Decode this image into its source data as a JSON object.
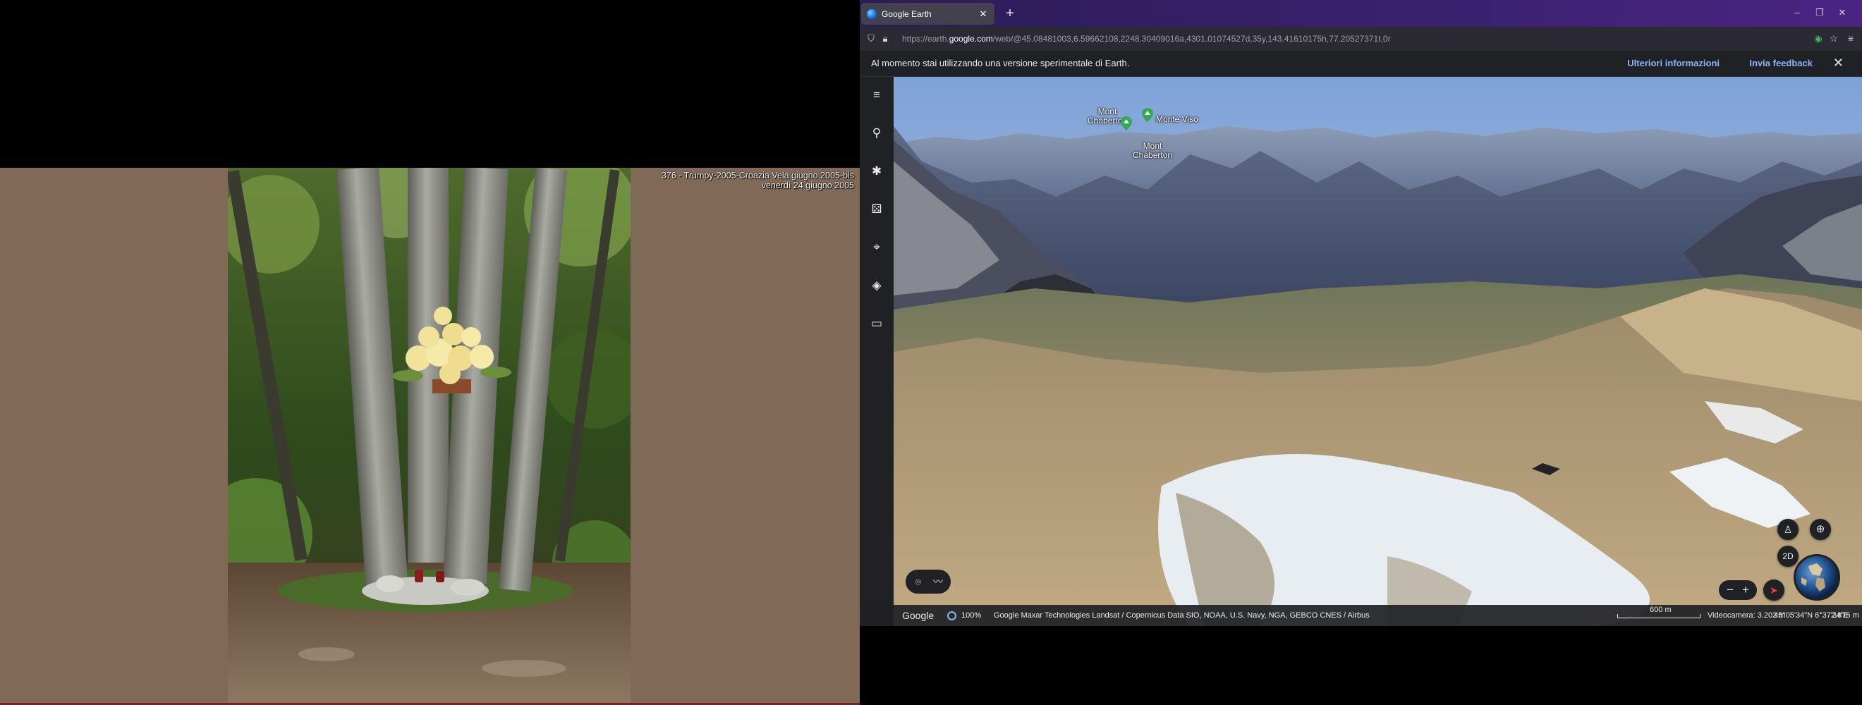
{
  "photo_viewer": {
    "caption_line1": "376 - Trumpy-2005-Croazia Vela giugno 2005-bis",
    "caption_line2": "venerdì 24 giugno 2005"
  },
  "browser": {
    "tab_title": "Google Earth",
    "tab_close_icon": "close-icon",
    "new_tab_glyph": "+",
    "window_controls": [
      "–",
      "❐",
      "✕"
    ],
    "url_prefix": "https://earth.",
    "url_host": "google.com",
    "url_path": "/web/@45.08481003,6.59662108,2248.30409016a,4301.01074527d,35y,143.41610175h,77.20527371t,0r"
  },
  "infobar": {
    "message": "Al momento stai utilizzando una versione sperimentale di Earth.",
    "more_info": "Ulteriori informazioni",
    "feedback": "Invia feedback",
    "close": "✕"
  },
  "earth": {
    "rail_icons": [
      "menu-icon",
      "search-icon",
      "voyager-icon",
      "dice-icon",
      "projects-icon",
      "layers-icon",
      "ruler-icon"
    ],
    "places": [
      {
        "name_line1": "Mont",
        "name_line2": "Chaberton"
      },
      {
        "name_line1": "Monte Viso",
        "name_line2": ""
      },
      {
        "name_line1": "Mont",
        "name_line2": "Chaberton"
      }
    ],
    "mode_2d": "2D",
    "zoom_minus": "−",
    "zoom_plus": "+",
    "colors": {
      "pin_green": "#34a853",
      "sky_top": "#7fa2d6",
      "snow": "#e8edf2",
      "ground": "#b49e78"
    }
  },
  "statusbar": {
    "google": "Google",
    "zoom_pct": "100%",
    "credits": "Google    Maxar Technologies    Landsat / Copernicus    Data SIO, NOAA, U.S. Navy, NGA, GEBCO    CNES / Airbus",
    "scale": "600 m",
    "camera": "Videocamera: 3.202 m",
    "coords": "45°05'34\"N 6°37'34\"E",
    "elevation": "2.875 m"
  }
}
